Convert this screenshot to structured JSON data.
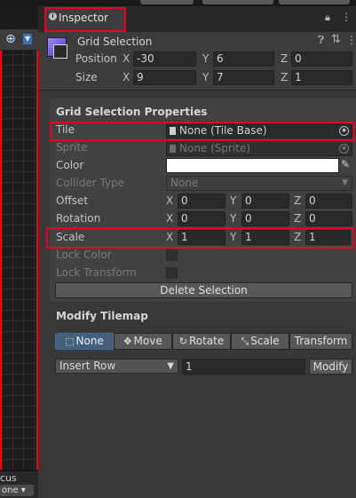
{
  "tabs": {
    "inspector": "Inspector"
  },
  "scene": {
    "focus_label": "cus",
    "tile_select": "one"
  },
  "component": {
    "title": "Grid Selection",
    "position": {
      "label": "Position",
      "x": "-30",
      "y": "6",
      "z": "0"
    },
    "size": {
      "label": "Size",
      "x": "9",
      "y": "7",
      "z": "1"
    }
  },
  "axis": {
    "x": "X",
    "y": "Y",
    "z": "Z"
  },
  "properties": {
    "title": "Grid Selection Properties",
    "tile": {
      "label": "Tile",
      "value": "None (Tile Base)"
    },
    "sprite": {
      "label": "Sprite",
      "value": "None (Sprite)"
    },
    "color": {
      "label": "Color",
      "value": "#ffffff"
    },
    "collider_type": {
      "label": "Collider Type",
      "value": "None"
    },
    "offset": {
      "label": "Offset",
      "x": "0",
      "y": "0",
      "z": "0"
    },
    "rotation": {
      "label": "Rotation",
      "x": "0",
      "y": "0",
      "z": "0"
    },
    "scale": {
      "label": "Scale",
      "x": "1",
      "y": "1",
      "z": "1"
    },
    "lock_color": {
      "label": "Lock Color"
    },
    "lock_transform": {
      "label": "Lock Transform"
    },
    "delete_button": "Delete Selection"
  },
  "modify": {
    "title": "Modify Tilemap",
    "tools": [
      "None",
      "Move",
      "Rotate",
      "Scale",
      "Transform"
    ],
    "active_tool": "None",
    "operation": "Insert Row",
    "count": "1",
    "modify_button": "Modify"
  },
  "colors": {
    "accent_red": "#e8001c",
    "active_blue": "#46607c"
  }
}
